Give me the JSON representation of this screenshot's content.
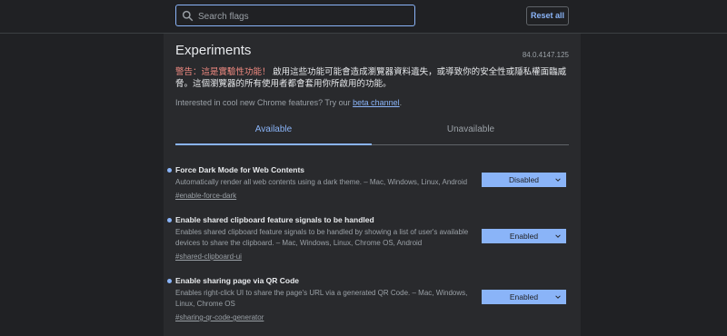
{
  "search": {
    "placeholder": "Search flags"
  },
  "reset_label": "Reset all",
  "page": {
    "title": "Experiments",
    "version": "84.0.4147.125",
    "warning_label": "警告：這是實驗性功能！",
    "warning_text": "啟用這些功能可能會造成瀏覽器資料遺失，或導致你的安全性或隱私權面臨威脅。這個瀏覽器的所有使用者都會套用你所啟用的功能。",
    "promo_text": "Interested in cool new Chrome features? Try our",
    "promo_link": "beta channel",
    "promo_end": "."
  },
  "tabs": [
    {
      "label": "Available"
    },
    {
      "label": "Unavailable"
    }
  ],
  "experiments": [
    {
      "name": "Force Dark Mode for Web Contents",
      "description": "Automatically render all web contents using a dark theme. – Mac, Windows, Linux, Android",
      "tag": "#enable-force-dark",
      "value": "Disabled"
    },
    {
      "name": "Enable shared clipboard feature signals to be handled",
      "description": "Enables shared clipboard feature signals to be handled by showing a list of user's available devices to share the clipboard. – Mac, Windows, Linux, Chrome OS, Android",
      "tag": "#shared-clipboard-ui",
      "value": "Enabled"
    },
    {
      "name": "Enable sharing page via QR Code",
      "description": "Enables right-click UI to share the page's URL via a generated QR Code. – Mac, Windows, Linux, Chrome OS",
      "tag": "#sharing-qr-code-generator",
      "value": "Enabled"
    }
  ],
  "colors": {
    "accent": "#8ab4f8",
    "background": "#202124",
    "panel": "#292a2d",
    "warning": "#f28b82"
  }
}
